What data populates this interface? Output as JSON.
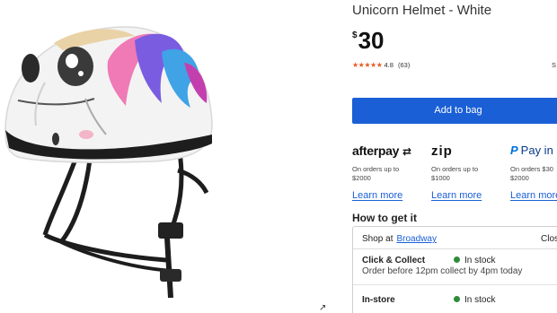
{
  "product": {
    "title": "Unicorn Helmet - White",
    "currency_symbol": "$",
    "price": "30",
    "stars": "★★★★★",
    "rating": "4.8",
    "review_count": "(63)",
    "cut_text": "S",
    "image_alt": "unicorn-helmet-image"
  },
  "actions": {
    "add_to_bag": "Add to bag"
  },
  "payments": [
    {
      "logo": "afterpay",
      "line1": "On orders up to",
      "line2": "$2000",
      "link": "Learn more"
    },
    {
      "logo": "zip",
      "line1": "On orders up to",
      "line2": "$1000",
      "link": "Learn more"
    },
    {
      "logo": "Pay in",
      "line1": "On orders $30",
      "line2": "$2000",
      "link": "Learn more"
    }
  ],
  "fulfilment": {
    "title": "How to get it",
    "shop_at_label": "Shop at",
    "store": "Broadway",
    "close_label": "Clos",
    "click_collect": {
      "label": "Click & Collect",
      "status": "In stock",
      "note": "Order before 12pm collect by 4pm today"
    },
    "in_store": {
      "label": "In-store",
      "status": "In stock"
    }
  },
  "colors": {
    "accent": "#1a5fd6",
    "star": "#e35b27",
    "in_stock": "#2e8b3a"
  }
}
